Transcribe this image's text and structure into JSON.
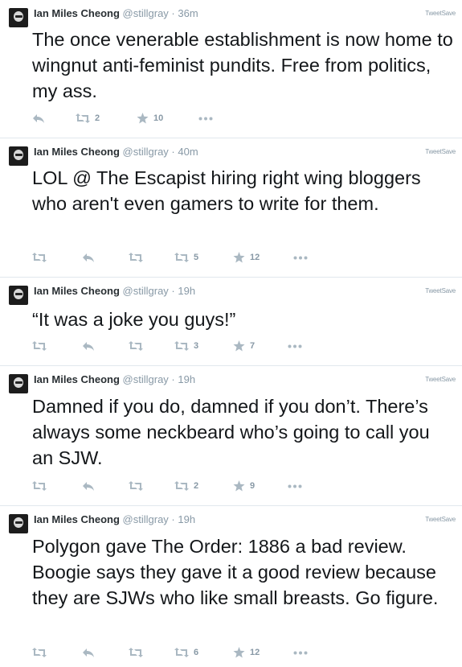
{
  "author": {
    "name": "Ian Miles Cheong",
    "handle": "@stillgray"
  },
  "tweetsave_label": "TweetSave",
  "tweets": [
    {
      "time": "36m",
      "text": "The once venerable establishment is now home to wingnut anti-feminist pundits. Free from politics, my ass.",
      "retweets": "2",
      "favorites": "10"
    },
    {
      "time": "40m",
      "text": "LOL @ The Escapist hiring right wing bloggers who aren't even gamers to write for them.",
      "retweets": "5",
      "favorites": "12"
    },
    {
      "time": "19h",
      "text": "“It was a joke you guys!”",
      "retweets": "3",
      "favorites": "7"
    },
    {
      "time": "19h",
      "text": "Damned if you do, damned if you don’t. There’s always some neckbeard who’s going to call you an SJW.",
      "retweets": "2",
      "favorites": "9"
    },
    {
      "time": "19h",
      "text": "Polygon gave The Order: 1886 a bad review. Boogie says they gave it a good review because they are SJWs who like small breasts. Go figure.",
      "retweets": "6",
      "favorites": "12"
    }
  ]
}
